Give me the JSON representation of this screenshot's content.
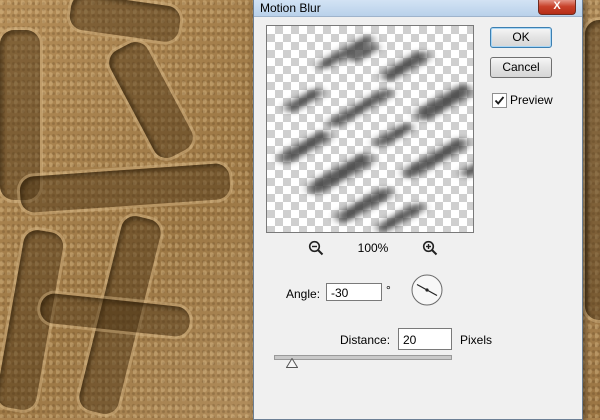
{
  "dialog": {
    "title": "Motion Blur",
    "close_glyph": "X",
    "ok_label": "OK",
    "cancel_label": "Cancel",
    "preview_label": "Preview",
    "preview_checked": true,
    "zoom_level": "100%",
    "zoom_out_icon": "zoom-out-magnifier",
    "zoom_in_icon": "zoom-in-magnifier",
    "angle_label": "Angle:",
    "angle_value": "-30",
    "angle_unit": "°",
    "distance_label": "Distance:",
    "distance_value": "20",
    "distance_unit": "Pixels",
    "slider_level_fraction": 0.04
  },
  "colors": {
    "titlebar": "#c8dcf0",
    "close_button": "#c8412a",
    "dialog_bg": "#f0f0f0",
    "background_sand": "#a9824f"
  }
}
